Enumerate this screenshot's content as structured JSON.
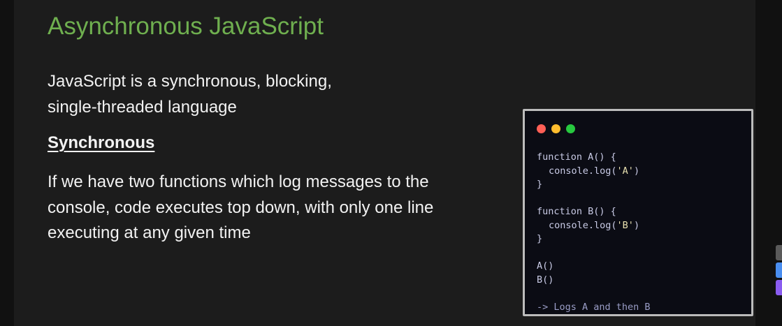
{
  "slide": {
    "title": "Asynchronous JavaScript",
    "intro_lines": [
      "JavaScript is a synchronous, blocking,",
      "single-threaded language"
    ],
    "subheading": "Synchronous",
    "body_lines": [
      "If we have two functions which log messages to the",
      "console, code executes top down, with only one line",
      "executing at any given time"
    ]
  },
  "code_window": {
    "window_controls": [
      {
        "name": "close-dot",
        "color": "#ff5f56"
      },
      {
        "name": "minimize-dot",
        "color": "#ffbd2e"
      },
      {
        "name": "maximize-dot",
        "color": "#27c93f"
      }
    ],
    "lines": {
      "l1": "function A() {",
      "l2_pre": "console.log(",
      "l2_str": "'A'",
      "l2_post": ")",
      "l3": "}",
      "l5": "function B() {",
      "l6_pre": "console.log(",
      "l6_str": "'B'",
      "l6_post": ")",
      "l7": "}",
      "l9": "A()",
      "l10": "B()",
      "l12": "-> Logs A and then B"
    }
  },
  "side_widgets": [
    {
      "name": "side-widget-grey",
      "color": "#5a5a5a"
    },
    {
      "name": "side-widget-blue",
      "color": "#4a8ef0"
    },
    {
      "name": "side-widget-purple",
      "color": "#8a5cf0"
    }
  ],
  "colors": {
    "title": "#6faf4f",
    "text": "#f2f2f2",
    "slide_background": "#1c1c1c",
    "code_background": "#0b0c14",
    "code_border": "#bcbcbc"
  }
}
